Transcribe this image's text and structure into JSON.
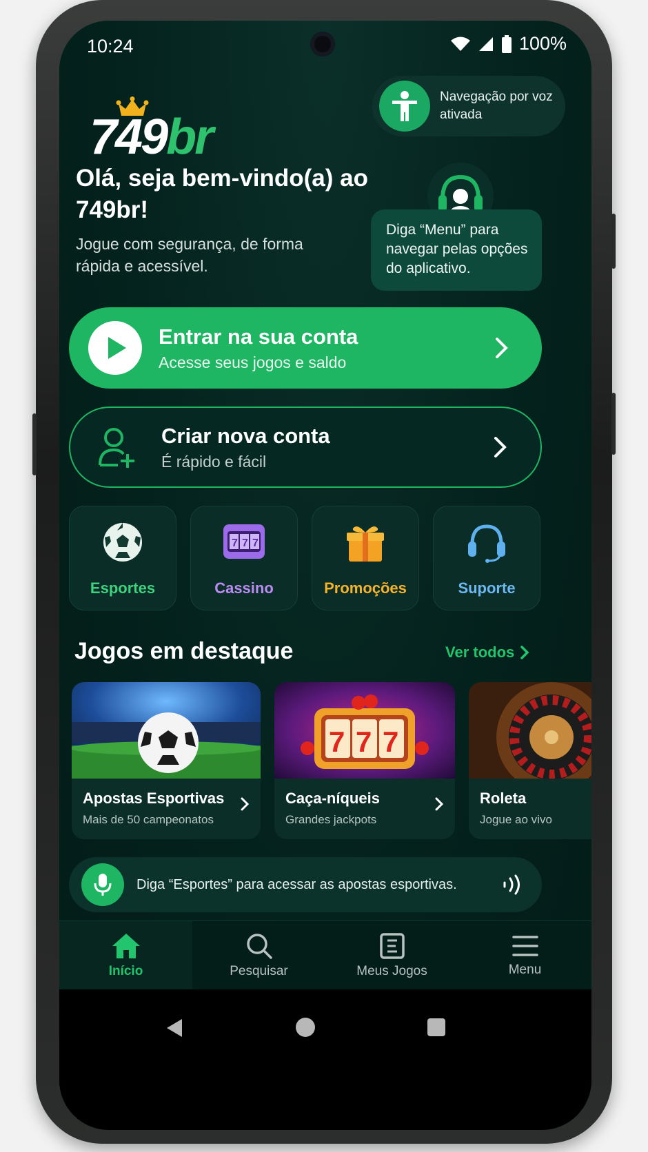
{
  "status_bar": {
    "time": "10:24",
    "battery": "100%"
  },
  "brand": {
    "logo_main": "749",
    "logo_accent": "br",
    "accent_color": "#1eb563"
  },
  "voice_status": {
    "text": "Navegação por voz ativada",
    "icon": "accessibility-icon"
  },
  "welcome": {
    "title": "Olá, seja bem-vindo(a) ao 749br!",
    "subtitle": "Jogue com segurança, de forma rápida e acessível."
  },
  "assistant": {
    "message": "Diga “Menu” para navegar pelas opções do aplicativo.",
    "icon": "headset-avatar-icon"
  },
  "login_button": {
    "title": "Entrar na sua conta",
    "subtitle": "Acesse seus jogos e saldo"
  },
  "create_button": {
    "title": "Criar nova conta",
    "subtitle": "É rápido e fácil"
  },
  "categories": [
    {
      "label": "Esportes",
      "icon": "soccer-ball-icon",
      "color": "#3ed17f"
    },
    {
      "label": "Cassino",
      "icon": "slot-machine-icon",
      "color": "#b98cf2"
    },
    {
      "label": "Promoções",
      "icon": "gift-icon",
      "color": "#f4b32b"
    },
    {
      "label": "Suporte",
      "icon": "headset-icon",
      "color": "#6db8f0"
    }
  ],
  "featured": {
    "title": "Jogos em destaque",
    "see_all": "Ver todos",
    "games": [
      {
        "title": "Apostas Esportivas",
        "subtitle": "Mais de 50 campeonatos"
      },
      {
        "title": "Caça-níqueis",
        "subtitle": "Grandes jackpots"
      },
      {
        "title": "Roleta",
        "subtitle": "Jogue ao vivo"
      }
    ]
  },
  "voice_hint": {
    "text": "Diga “Esportes” para acessar as apostas esportivas."
  },
  "bottom_nav": [
    {
      "label": "Início",
      "icon": "home-icon",
      "active": true
    },
    {
      "label": "Pesquisar",
      "icon": "search-icon",
      "active": false
    },
    {
      "label": "Meus Jogos",
      "icon": "ticket-icon",
      "active": false
    },
    {
      "label": "Menu",
      "icon": "hamburger-icon",
      "active": false
    }
  ]
}
